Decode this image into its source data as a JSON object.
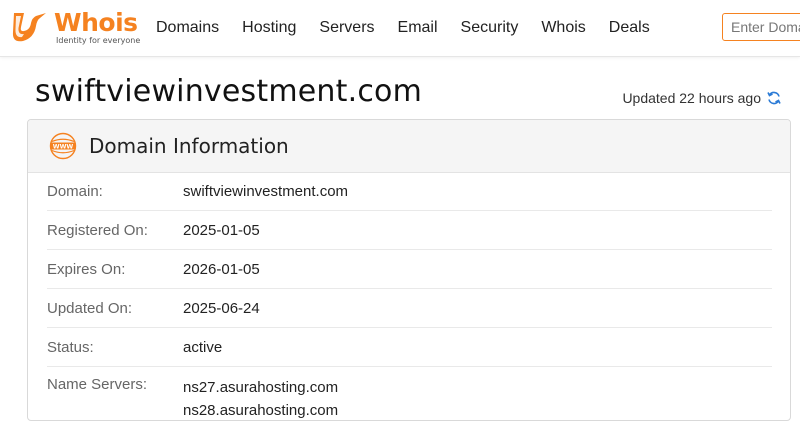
{
  "brand": {
    "name_part1": "Who",
    "name_part2": "is",
    "tagline": "Identity for everyone",
    "accent_color": "#f58220"
  },
  "nav": {
    "items": [
      {
        "label": "Domains"
      },
      {
        "label": "Hosting"
      },
      {
        "label": "Servers"
      },
      {
        "label": "Email"
      },
      {
        "label": "Security"
      },
      {
        "label": "Whois"
      },
      {
        "label": "Deals"
      }
    ]
  },
  "search": {
    "placeholder": "Enter Domain or IP"
  },
  "page": {
    "title": "swiftviewinvestment.com",
    "updated": "Updated 22 hours ago",
    "refresh_icon": "refresh-icon",
    "refresh_color": "#2b7bd6"
  },
  "card": {
    "title": "Domain Information",
    "icon": "www-icon",
    "rows": [
      {
        "label": "Domain:",
        "value": "swiftviewinvestment.com"
      },
      {
        "label": "Registered On:",
        "value": "2025-01-05"
      },
      {
        "label": "Expires On:",
        "value": "2026-01-05"
      },
      {
        "label": "Updated On:",
        "value": "2025-06-24"
      },
      {
        "label": "Status:",
        "value": "active"
      },
      {
        "label": "Name Servers:",
        "values": [
          "ns27.asurahosting.com",
          "ns28.asurahosting.com"
        ]
      }
    ]
  }
}
